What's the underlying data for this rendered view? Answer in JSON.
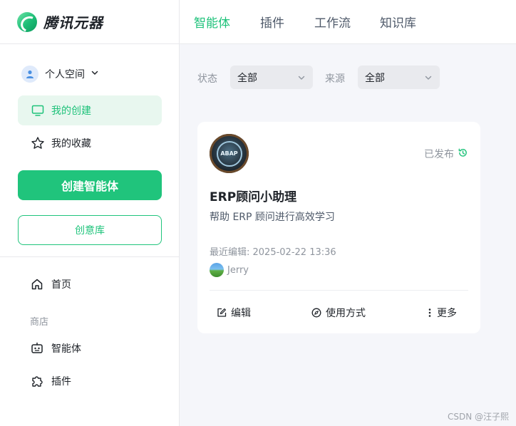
{
  "brand": {
    "name": "腾讯元器"
  },
  "sidebar": {
    "space_label": "个人空间",
    "items": [
      {
        "label": "我的创建",
        "icon": "monitor-icon",
        "active": true
      },
      {
        "label": "我的收藏",
        "icon": "star-icon",
        "active": false
      }
    ],
    "create_button": "创建智能体",
    "idea_button": "创意库",
    "home_label": "首页",
    "store_section": "商店",
    "store_items": [
      {
        "label": "智能体",
        "icon": "robot-icon"
      },
      {
        "label": "插件",
        "icon": "puzzle-icon"
      }
    ]
  },
  "topbar": {
    "tabs": [
      {
        "label": "智能体",
        "active": true
      },
      {
        "label": "插件",
        "active": false
      },
      {
        "label": "工作流",
        "active": false
      },
      {
        "label": "知识库",
        "active": false
      }
    ]
  },
  "filters": {
    "status_label": "状态",
    "status_value": "全部",
    "source_label": "来源",
    "source_value": "全部"
  },
  "card": {
    "avatar_text": "ABAP",
    "status": "已发布",
    "title": "ERP顾问小助理",
    "description": "帮助 ERP 顾问进行高效学习",
    "last_edit": "最近编辑: 2025-02-22 13:36",
    "author": "Jerry",
    "actions": {
      "edit": "编辑",
      "usage": "使用方式",
      "more": "更多"
    }
  },
  "watermark": "CSDN @汪子熙",
  "colors": {
    "accent": "#20c47c",
    "active_bg": "#e8f7ef",
    "text_primary": "#1f2329",
    "text_secondary": "#8f959e"
  }
}
